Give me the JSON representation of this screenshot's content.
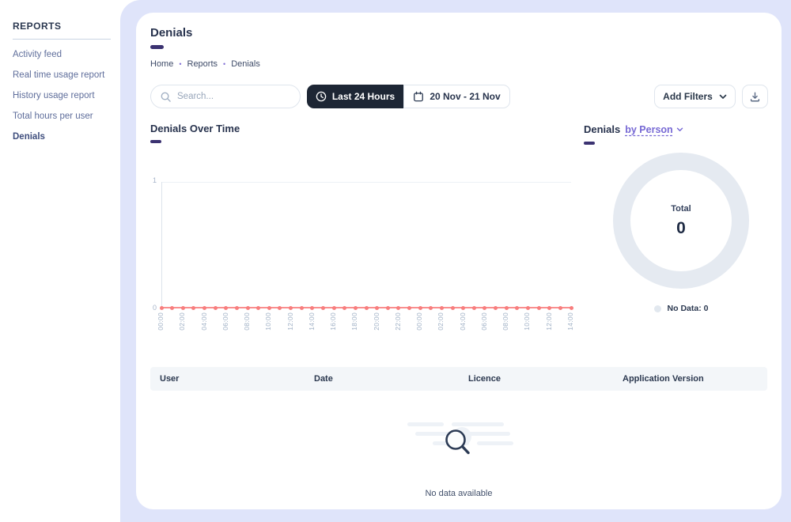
{
  "sidebar": {
    "heading": "REPORTS",
    "items": [
      {
        "label": "Activity feed",
        "active": false
      },
      {
        "label": "Real time usage report",
        "active": false
      },
      {
        "label": "History usage report",
        "active": false
      },
      {
        "label": "Total hours per user",
        "active": false
      },
      {
        "label": "Denials",
        "active": true
      }
    ]
  },
  "header": {
    "title": "Denials",
    "breadcrumb": [
      "Home",
      "Reports",
      "Denials"
    ]
  },
  "toolbar": {
    "search_placeholder": "Search...",
    "search_value": "",
    "range_label": "Last 24 Hours",
    "date_label": "20 Nov - 21 Nov",
    "filters_label": "Add Filters"
  },
  "charts": {
    "over_time_title": "Denials Over Time",
    "by_title": "Denials",
    "by_selector": "by Person",
    "donut_center_label": "Total",
    "donut_center_value": "0",
    "donut_legend": "No Data: 0"
  },
  "table": {
    "headers": [
      "User",
      "Date",
      "Licence",
      "Application Version"
    ],
    "rows": [],
    "empty_text": "No data available"
  },
  "colors": {
    "accent_bar": "#3b3271",
    "content_background": "#dfe4fa",
    "dark_button": "#1d2634",
    "line_series": "#f87e7e",
    "donut_ring": "#e5eaf1",
    "selector_link": "#7668d4"
  },
  "chart_data": [
    {
      "type": "line",
      "title": "Denials Over Time",
      "x": [
        "00:00",
        "01:00",
        "02:00",
        "03:00",
        "04:00",
        "05:00",
        "06:00",
        "07:00",
        "08:00",
        "09:00",
        "10:00",
        "11:00",
        "12:00",
        "13:00",
        "14:00",
        "15:00",
        "16:00",
        "17:00",
        "18:00",
        "19:00",
        "20:00",
        "21:00",
        "22:00",
        "23:00",
        "00:00",
        "01:00",
        "02:00",
        "03:00",
        "04:00",
        "05:00",
        "06:00",
        "07:00",
        "08:00",
        "09:00",
        "10:00",
        "11:00",
        "12:00",
        "13:00",
        "14:00"
      ],
      "values": [
        0,
        0,
        0,
        0,
        0,
        0,
        0,
        0,
        0,
        0,
        0,
        0,
        0,
        0,
        0,
        0,
        0,
        0,
        0,
        0,
        0,
        0,
        0,
        0,
        0,
        0,
        0,
        0,
        0,
        0,
        0,
        0,
        0,
        0,
        0,
        0,
        0,
        0,
        0
      ],
      "xlabel": "",
      "ylabel": "",
      "ylim": [
        0,
        1
      ],
      "yticks": [
        0,
        1
      ],
      "x_tick_every": 2,
      "grid": "top-line-only",
      "series_color": "#f87e7e",
      "legend_position": "none"
    },
    {
      "type": "pie",
      "subtype": "donut",
      "title": "Denials by Person",
      "slices": [
        {
          "label": "No Data",
          "value": 0
        }
      ],
      "total": 0,
      "center_label": "Total",
      "center_value": 0,
      "legend_position": "bottom"
    }
  ]
}
